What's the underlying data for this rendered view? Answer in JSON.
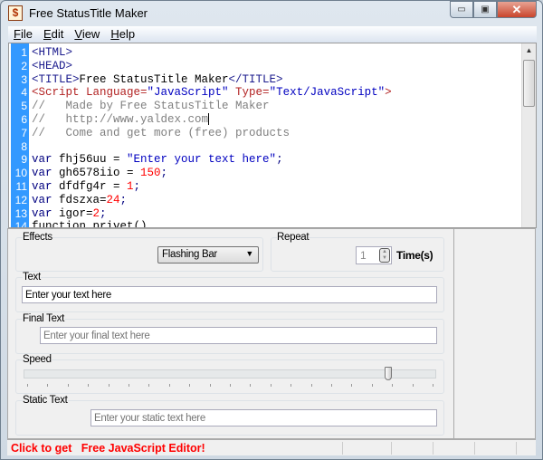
{
  "window": {
    "title": "Free StatusTitle Maker",
    "icon": "dollar-app-icon",
    "controls": [
      "minimize",
      "maximize",
      "close"
    ]
  },
  "menu": [
    {
      "label": "File",
      "key": "F"
    },
    {
      "label": "Edit",
      "key": "E"
    },
    {
      "label": "View",
      "key": "V"
    },
    {
      "label": "Help",
      "key": "H"
    }
  ],
  "editor": {
    "lines": [
      [
        [
          "<HTML>",
          "tag"
        ]
      ],
      [
        [
          "<HEAD>",
          "tag"
        ]
      ],
      [
        [
          "<TITLE>",
          "tag"
        ],
        [
          "Free StatusTitle Maker",
          "pl"
        ],
        [
          "</TITLE>",
          "tag"
        ]
      ],
      [
        [
          "<Script Language=",
          "red"
        ],
        [
          "\"JavaScript\"",
          "str"
        ],
        [
          " Type=",
          "red"
        ],
        [
          "\"Text/JavaScript\"",
          "str"
        ],
        [
          ">",
          "red"
        ]
      ],
      [
        [
          "//   Made by Free StatusTitle Maker",
          "cm"
        ]
      ],
      [
        [
          "//   http://www.yaldex.com",
          "cm"
        ]
      ],
      [
        [
          "//   Come and get more (free) products",
          "cm"
        ]
      ],
      [],
      [
        [
          "var ",
          "kw"
        ],
        [
          "fhj56uu = ",
          "pl"
        ],
        [
          "\"Enter your text here\"",
          "str"
        ],
        [
          ";",
          "kw"
        ]
      ],
      [
        [
          "var ",
          "kw"
        ],
        [
          "gh6578iio = ",
          "pl"
        ],
        [
          "150",
          "num"
        ],
        [
          ";",
          "kw"
        ]
      ],
      [
        [
          "var ",
          "kw"
        ],
        [
          "dfdfg4r = ",
          "pl"
        ],
        [
          "1",
          "num"
        ],
        [
          ";",
          "kw"
        ]
      ],
      [
        [
          "var ",
          "kw"
        ],
        [
          "fdszxa=",
          "pl"
        ],
        [
          "24",
          "num"
        ],
        [
          ";",
          "kw"
        ]
      ],
      [
        [
          "var ",
          "kw"
        ],
        [
          "igor=",
          "pl"
        ],
        [
          "2",
          "num"
        ],
        [
          ";",
          "kw"
        ]
      ],
      [
        [
          "function privet()",
          "pl"
        ]
      ]
    ],
    "caret_line": 6
  },
  "form": {
    "effects": {
      "label": "Effects",
      "selected": "Flashing Bar"
    },
    "repeat": {
      "label": "Repeat",
      "value": "1",
      "unit": "Time(s)"
    },
    "text": {
      "label": "Text",
      "value": "Enter your text here"
    },
    "final_text": {
      "label": "Final Text",
      "placeholder": "Enter your final text here"
    },
    "speed": {
      "label": "Speed",
      "level_fraction": 0.89,
      "ticks": 20
    },
    "static_text": {
      "label": "Static Text",
      "placeholder": "Enter your static text here"
    }
  },
  "status": {
    "promo": "Click to get   Free JavaScript Editor!",
    "promo_color": "#ff0000"
  },
  "colors": {
    "gutter": "#3399ff"
  }
}
